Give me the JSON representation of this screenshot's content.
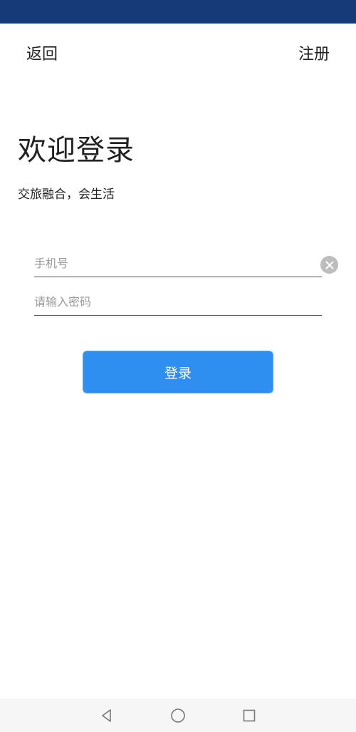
{
  "header": {
    "back_label": "返回",
    "register_label": "注册"
  },
  "title": "欢迎登录",
  "subtitle": "交旅融合，会生活",
  "form": {
    "phone_placeholder": "手机号",
    "phone_value": "",
    "password_placeholder": "请输入密码",
    "password_value": "",
    "clear_icon": "clear-circle-icon"
  },
  "login_label": "登录",
  "system_nav": {
    "back_icon": "triangle-back-icon",
    "home_icon": "circle-home-icon",
    "recent_icon": "square-recent-icon"
  },
  "colors": {
    "status_bar": "#163a78",
    "accent": "#2f8ff0"
  }
}
